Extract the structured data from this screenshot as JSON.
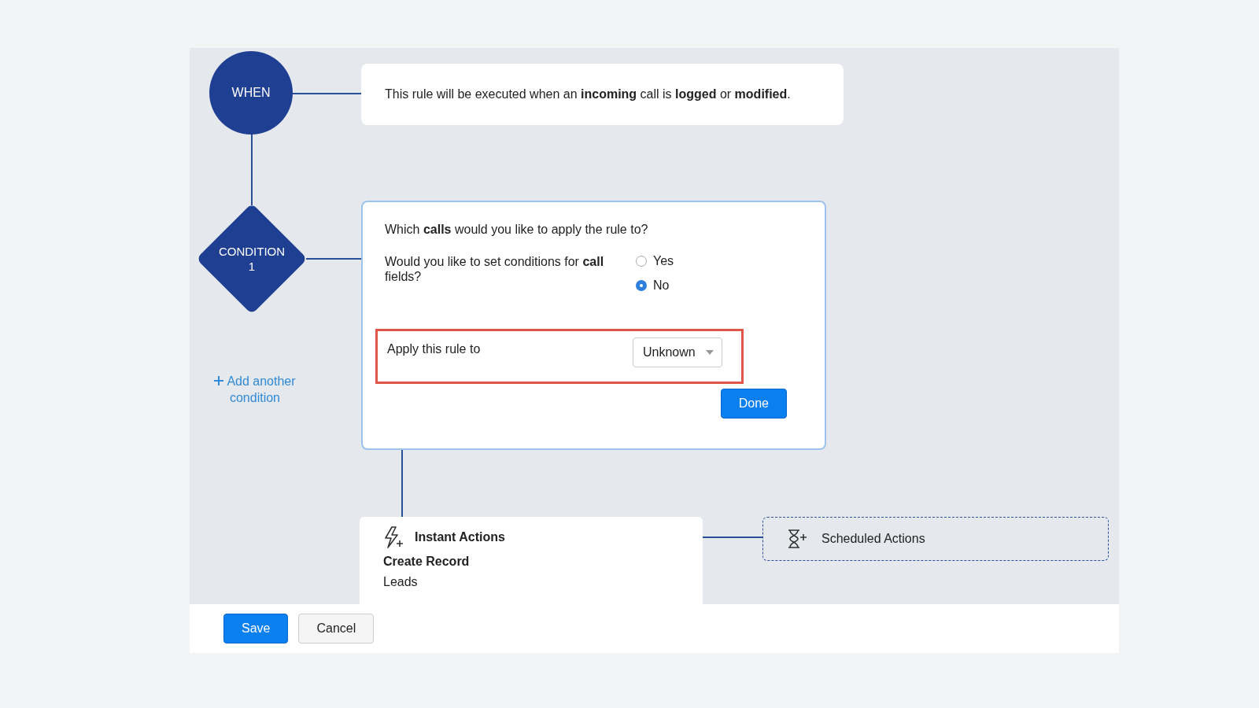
{
  "trigger": {
    "label": "WHEN",
    "description": "This rule will be executed when an **incoming** call is **logged** or **modified**."
  },
  "condition": {
    "label": "CONDITION",
    "number": "1",
    "question": "Which **calls** would you like to apply the rule to?",
    "set_conditions": {
      "label": "Would you like to set conditions for **call** fields?",
      "options": [
        {
          "label": "Yes",
          "selected": false
        },
        {
          "label": "No",
          "selected": true
        }
      ]
    },
    "apply": {
      "label": "Apply this rule to",
      "value": "Unknown",
      "highlighted": true
    },
    "done_button": "Done"
  },
  "add_condition": "Add another condition",
  "instant_actions": {
    "title": "Instant Actions",
    "actions": [
      {
        "name": "Create Record",
        "module": "Leads"
      }
    ]
  },
  "scheduled_actions": {
    "title": "Scheduled Actions"
  },
  "footer": {
    "buttons": [
      {
        "label": "Save",
        "kind": "primary"
      },
      {
        "label": "Cancel",
        "kind": "secondary"
      }
    ]
  }
}
